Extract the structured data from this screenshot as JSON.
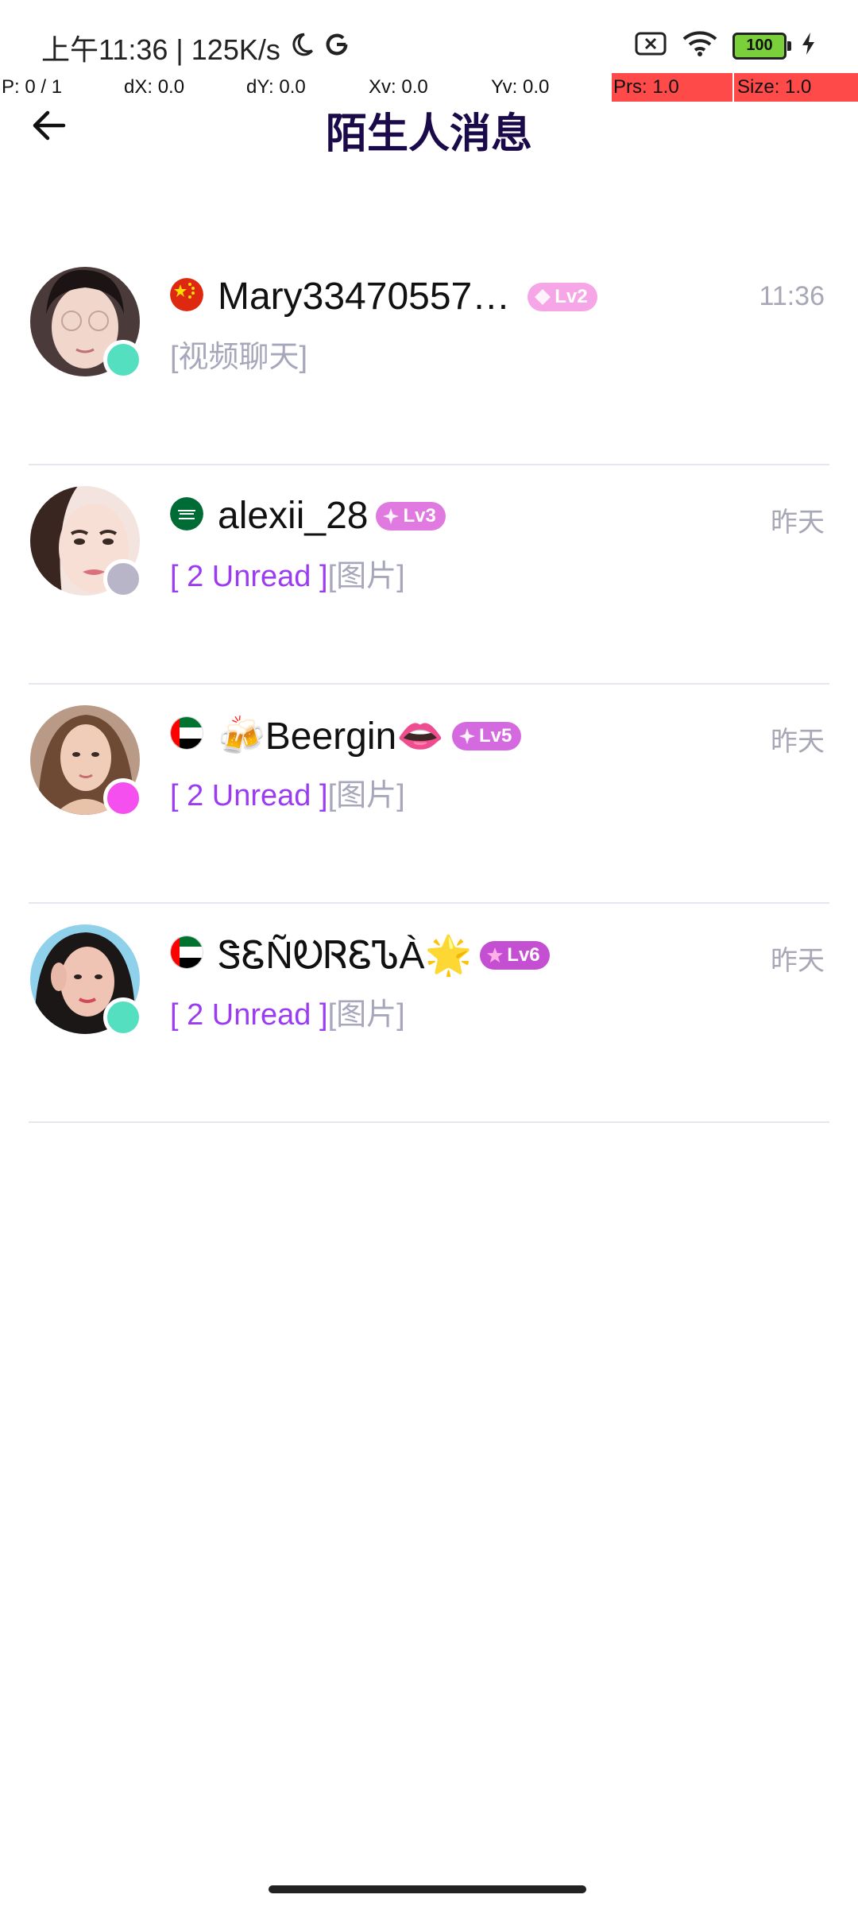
{
  "status_bar": {
    "time": "上午11:36 | 125K/s",
    "battery": "100"
  },
  "debug": {
    "p": "P: 0 / 1",
    "dx": "dX: 0.0",
    "dy": "dY: 0.0",
    "xv": "Xv: 0.0",
    "yv": "Yv: 0.0",
    "prs": "Prs: 1.0",
    "size": "Size: 1.0"
  },
  "header": {
    "title": "陌生人消息"
  },
  "conversations": [
    {
      "name": "Mary33470557…",
      "level": "Lv2",
      "time": "11:36",
      "unread": "",
      "preview": "[视频聊天]",
      "flag": "china-flag-icon",
      "status_color": "#55dfc1",
      "badge_color": "#f6a6e6"
    },
    {
      "name": "alexii_28",
      "level": "Lv3",
      "time": "昨天",
      "unread": "[ 2 Unread ]",
      "preview": "[图片]",
      "flag": "saudi-flag-icon",
      "status_color": "#b8b5c8",
      "badge_color": "#e17ae0"
    },
    {
      "name": "🍻Beergin👄",
      "level": "Lv5",
      "time": "昨天",
      "unread": "[ 2 Unread ]",
      "preview": "[图片]",
      "flag": "uae-flag-icon",
      "status_color": "#f54ff0",
      "badge_color": "#d56ae0"
    },
    {
      "name": "ᏕᏋÑᎧᏒᏋᏖÀ🌟",
      "level": "Lv6",
      "time": "昨天",
      "unread": "[ 2 Unread ]",
      "preview": "[图片]",
      "flag": "uae-flag-icon",
      "status_color": "#55dfc1",
      "badge_color": "#c44fd2"
    }
  ]
}
